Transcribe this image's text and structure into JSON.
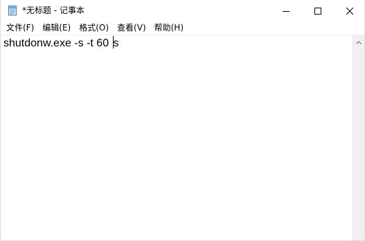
{
  "window": {
    "title": "*无标题 - 记事本",
    "icons": {
      "app": "notepad-icon",
      "minimize": "minimize-icon",
      "maximize": "maximize-icon",
      "close": "close-icon"
    }
  },
  "menubar": {
    "items": [
      {
        "label": "文件(F)"
      },
      {
        "label": "编辑(E)"
      },
      {
        "label": "格式(O)"
      },
      {
        "label": "查看(V)"
      },
      {
        "label": "帮助(H)"
      }
    ]
  },
  "editor": {
    "text_before_caret": "shutdonw.exe -s -t 60 ",
    "text_after_caret": "s"
  },
  "scrollbar": {
    "up_icon": "scroll-up-arrow-icon"
  }
}
